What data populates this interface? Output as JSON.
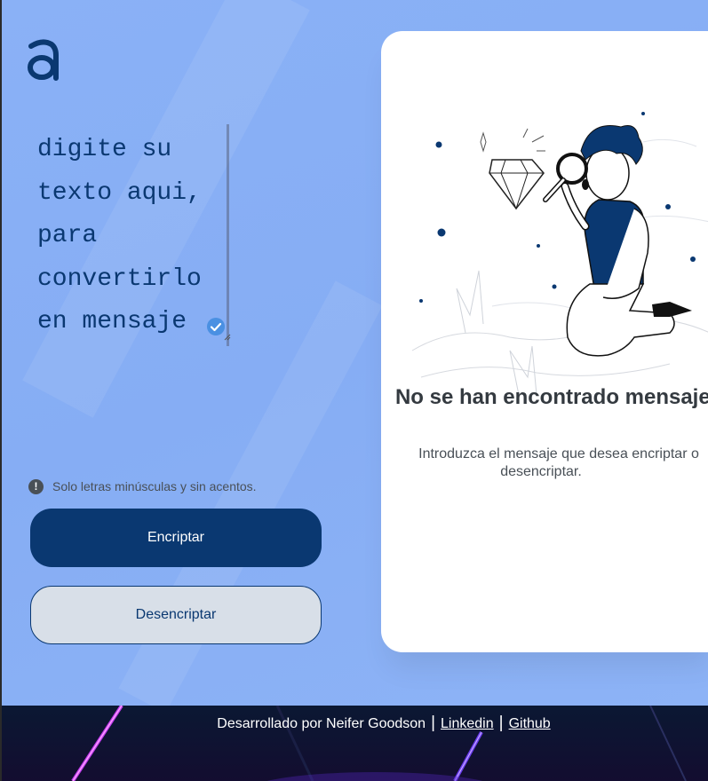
{
  "input": {
    "text": "digite su texto aqui, para convertirlo en mensaje"
  },
  "hint": {
    "icon": "info-icon",
    "text": "Solo letras minúsculas y sin acentos."
  },
  "buttons": {
    "encrypt_label": "Encriptar",
    "decrypt_label": "Desencriptar"
  },
  "result": {
    "title": "No se han encontrado mensajes",
    "subtitle_line1": "Introduzca el mensaje que desea encriptar o",
    "subtitle_line2": "desencriptar."
  },
  "footer": {
    "credit_text": "Desarrollado por Neifer Goodson",
    "separator": "|",
    "linkedin_label": "Linkedin",
    "github_label": "Github"
  },
  "colors": {
    "background": "#89b0f5",
    "primary": "#0a3871",
    "secondary_button": "#d8dfe8",
    "card": "#ffffff",
    "footer": "#0b1833"
  }
}
